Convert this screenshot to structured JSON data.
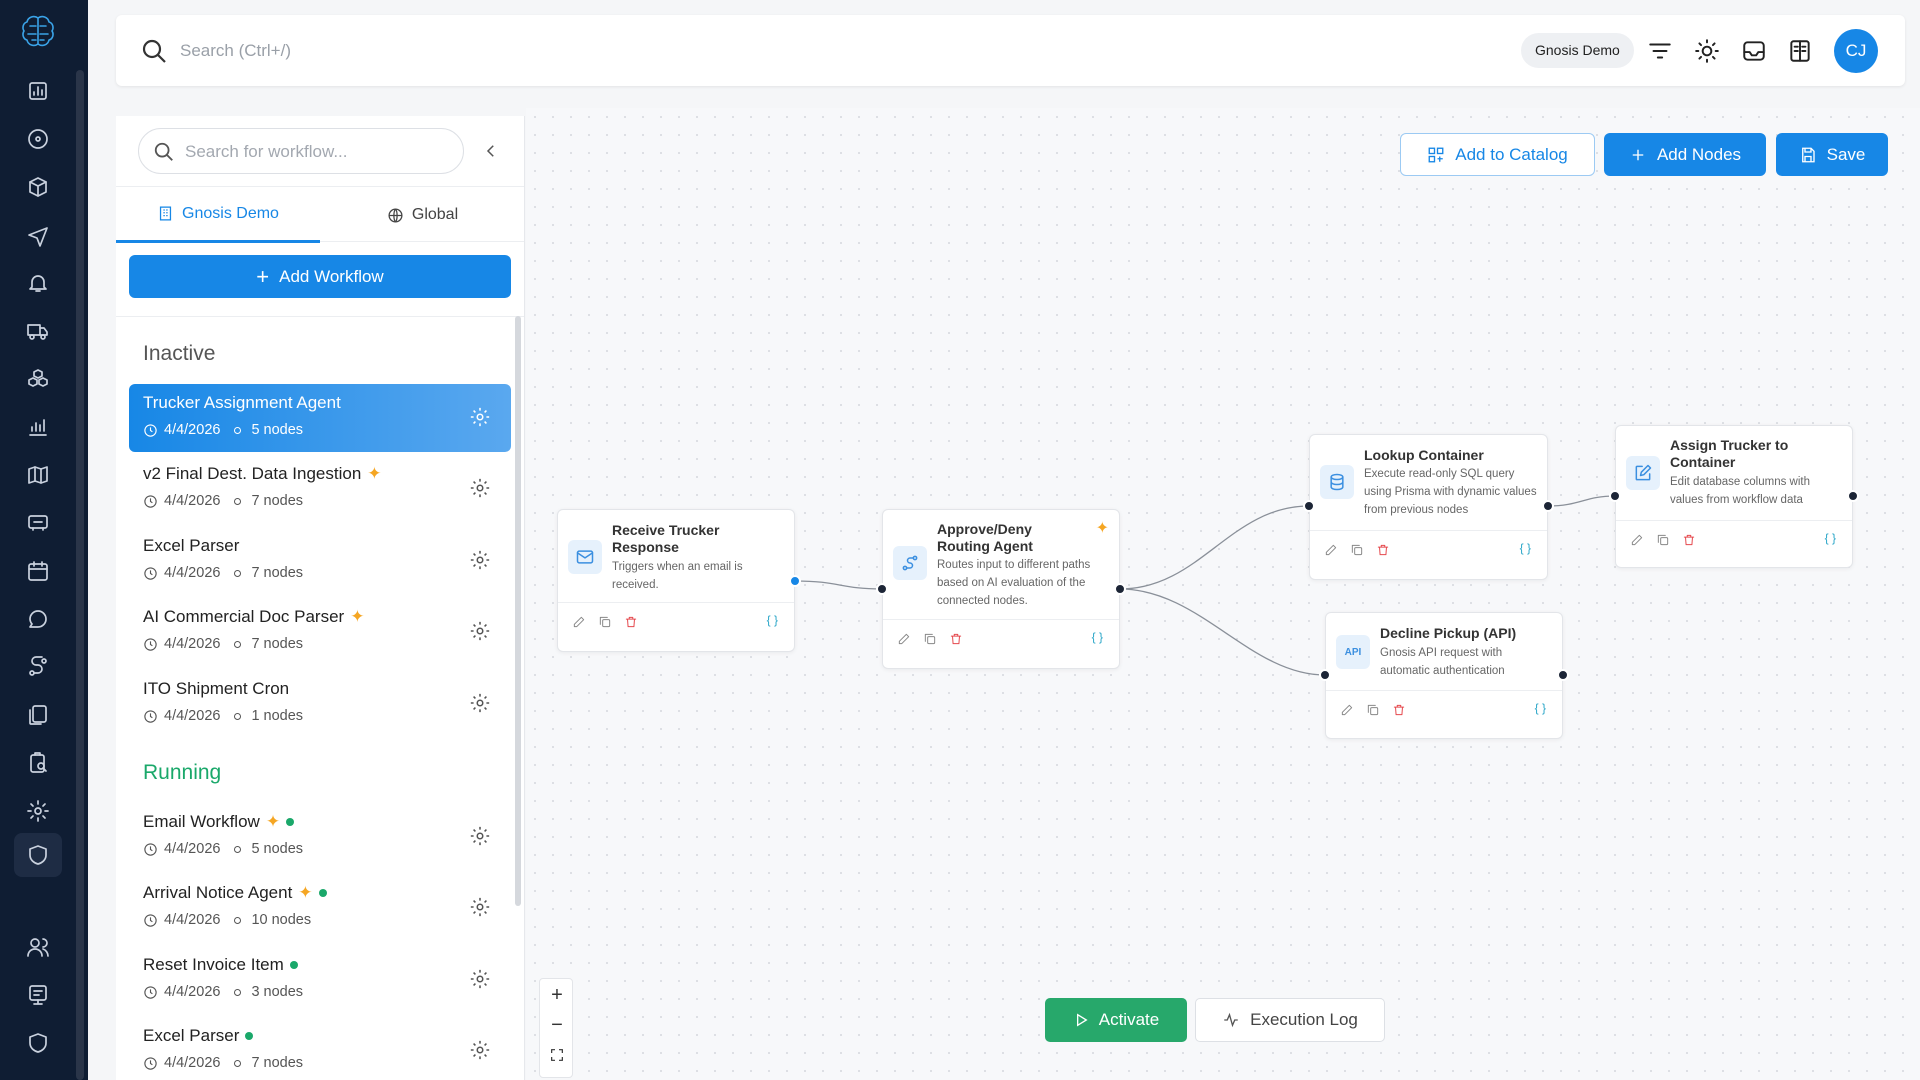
{
  "header": {
    "search_placeholder": "Search (Ctrl+/)",
    "org_name": "Gnosis Demo",
    "avatar_initials": "CJ"
  },
  "panel": {
    "search_placeholder": "Search for workflow...",
    "tabs": [
      {
        "label": "Gnosis Demo",
        "icon": "building-icon",
        "active": true
      },
      {
        "label": "Global",
        "icon": "globe-icon",
        "active": false
      }
    ],
    "add_workflow_label": "Add Workflow",
    "sections": {
      "inactive": "Inactive",
      "running": "Running"
    },
    "inactive_items": [
      {
        "name": "Trucker Assignment Agent",
        "date": "4/4/2026",
        "nodes": "5 nodes",
        "ai": false,
        "selected": true
      },
      {
        "name": "v2 Final Dest. Data Ingestion",
        "date": "4/4/2026",
        "nodes": "7 nodes",
        "ai": true
      },
      {
        "name": "Excel Parser",
        "date": "4/4/2026",
        "nodes": "7 nodes",
        "ai": false
      },
      {
        "name": "AI Commercial Doc Parser",
        "date": "4/4/2026",
        "nodes": "7 nodes",
        "ai": true
      },
      {
        "name": "ITO Shipment Cron",
        "date": "4/4/2026",
        "nodes": "1 nodes",
        "ai": false
      }
    ],
    "running_items": [
      {
        "name": "Email Workflow",
        "date": "4/4/2026",
        "nodes": "5 nodes",
        "ai": true
      },
      {
        "name": "Arrival Notice Agent",
        "date": "4/4/2026",
        "nodes": "10 nodes",
        "ai": true
      },
      {
        "name": "Reset Invoice Item",
        "date": "4/4/2026",
        "nodes": "3 nodes",
        "ai": false
      },
      {
        "name": "Excel Parser",
        "date": "4/4/2026",
        "nodes": "7 nodes",
        "ai": false
      }
    ]
  },
  "canvas": {
    "add_to_catalog_label": "Add to Catalog",
    "add_nodes_label": "Add Nodes",
    "save_label": "Save",
    "activate_label": "Activate",
    "execution_log_label": "Execution Log",
    "nodes": {
      "receive": {
        "title": "Receive Trucker Response",
        "desc": "Triggers when an email is received.",
        "icon": "mail-icon"
      },
      "route": {
        "title": "Approve/Deny Routing Agent",
        "desc": "Routes input to different paths based on AI evaluation of the connected nodes.",
        "icon": "route-icon"
      },
      "lookup": {
        "title": "Lookup Container",
        "desc": "Execute read-only SQL query using Prisma with dynamic values from previous nodes",
        "icon": "database-icon"
      },
      "assign": {
        "title": "Assign Trucker to Container",
        "desc": "Edit database columns with values from workflow data",
        "icon": "edit-icon"
      },
      "decline": {
        "title": "Decline Pickup (API)",
        "desc": "Gnosis API request with automatic authentication",
        "icon": "api-icon",
        "icon_text": "API"
      }
    },
    "braces": "{ }"
  },
  "colors": {
    "primary": "#1787e6",
    "running": "#1aa86a",
    "activate": "#27a86b",
    "rail": "#0f1d33",
    "ai_sparkle": "#f5a623",
    "delete": "#e5484d"
  }
}
